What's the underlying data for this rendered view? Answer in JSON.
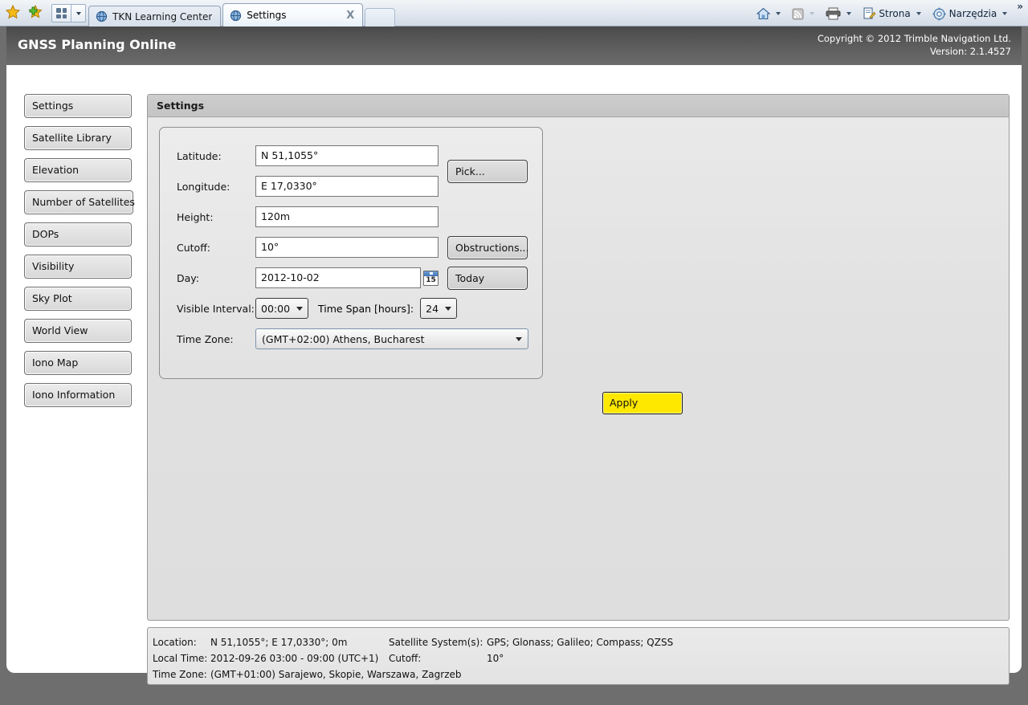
{
  "browser": {
    "favorites_icon": "star-icon",
    "add_favorites_icon": "add-favorite-star-icon",
    "quick_tabs_icon": "quick-tabs-grid-icon",
    "tabs": [
      {
        "label": "TKN Learning Center",
        "active": false,
        "icon": "globe-icon"
      },
      {
        "label": "Settings",
        "active": true,
        "icon": "globe-icon",
        "close": "X"
      }
    ],
    "commands": {
      "home": "home-icon",
      "feeds": "rss-feed-icon",
      "print": "printer-icon",
      "page_label": "Strona",
      "page_icon": "page-icon",
      "tools_label": "Narzędzia",
      "tools_icon": "gear-icon",
      "overflow": "»"
    }
  },
  "app": {
    "title": "GNSS Planning Online",
    "copyright": "Copyright ©  2012 Trimble Navigation Ltd.",
    "version": "Version: 2.1.4527"
  },
  "sidebar": {
    "items": [
      {
        "label": "Settings"
      },
      {
        "label": "Satellite Library"
      },
      {
        "label": "Elevation"
      },
      {
        "label": "Number of Satellites"
      },
      {
        "label": "DOPs"
      },
      {
        "label": "Visibility"
      },
      {
        "label": "Sky Plot"
      },
      {
        "label": "World View"
      },
      {
        "label": "Iono Map"
      },
      {
        "label": "Iono Information"
      }
    ]
  },
  "panel": {
    "header": "Settings"
  },
  "form": {
    "latitude": {
      "label": "Latitude:",
      "value": "N 51,1055°"
    },
    "longitude": {
      "label": "Longitude:",
      "value": "E 17,0330°"
    },
    "height": {
      "label": "Height:",
      "value": "120m"
    },
    "cutoff": {
      "label": "Cutoff:",
      "value": "10°"
    },
    "day": {
      "label": "Day:",
      "value": "2012-10-02",
      "calendar_day": "15"
    },
    "visible_interval": {
      "label": "Visible Interval:",
      "value": "00:00"
    },
    "time_span": {
      "label": "Time Span [hours]:",
      "value": "24"
    },
    "time_zone": {
      "label": "Time Zone:",
      "value": "(GMT+02:00) Athens, Bucharest"
    },
    "pick_button": "Pick...",
    "obstructions_button": "Obstructions...",
    "today_button": "Today",
    "apply_button": "Apply",
    "apply_color": "#ffe800"
  },
  "status": {
    "location_label": "Location:",
    "location_value": "N 51,1055°; E 17,0330°; 0m",
    "satellite_label": "Satellite System(s):",
    "satellite_value": "GPS; Glonass; Galileo; Compass; QZSS",
    "local_time_label": "Local Time:",
    "local_time_value": "2012-09-26 03:00 - 09:00 (UTC+1)",
    "cutoff_label": "Cutoff:",
    "cutoff_value": "10°",
    "time_zone_label": "Time Zone:",
    "time_zone_value": "(GMT+01:00) Sarajewo, Skopie, Warszawa, Zagrzeb"
  }
}
